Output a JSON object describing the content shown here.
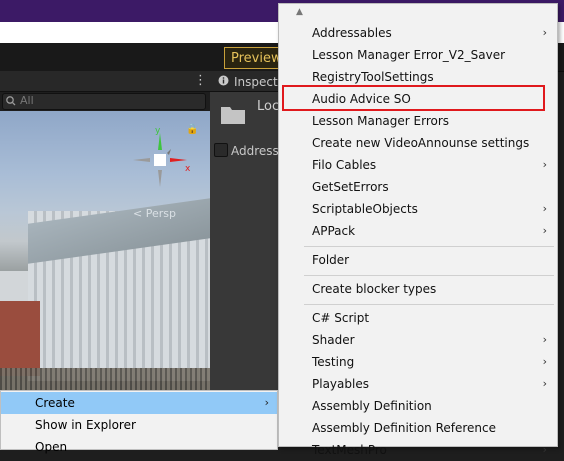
{
  "toolbar": {
    "preview_label": "Preview"
  },
  "scene": {
    "search_placeholder": "All",
    "persp_label": "< Persp",
    "gizmo": {
      "y_label": "y",
      "x_label": "x"
    }
  },
  "inspector": {
    "title": "Inspecto",
    "asset_label": "Loc",
    "address_label": "Address"
  },
  "context_menu": {
    "items": [
      {
        "label": "Create",
        "submenu": true
      },
      {
        "label": "Show in Explorer",
        "submenu": false
      },
      {
        "label": "Open",
        "submenu": false
      }
    ]
  },
  "create_menu": {
    "items": [
      {
        "label": "Addressables",
        "submenu": true
      },
      {
        "label": "Lesson Manager Error_V2_Saver",
        "submenu": false
      },
      {
        "label": "RegistryToolSettings",
        "submenu": false
      },
      {
        "label": "Audio Advice SO",
        "submenu": false
      },
      {
        "label": "Lesson Manager Errors",
        "submenu": false
      },
      {
        "label": "Create new VideoAnnounse settings",
        "submenu": false
      },
      {
        "label": "Filo Cables",
        "submenu": true
      },
      {
        "label": "GetSetErrors",
        "submenu": false
      },
      {
        "label": "ScriptableObjects",
        "submenu": true
      },
      {
        "label": "APPack",
        "submenu": true
      },
      {
        "label": "Folder",
        "submenu": false
      },
      {
        "label": "Create blocker types",
        "submenu": false
      },
      {
        "label": "C# Script",
        "submenu": false
      },
      {
        "label": "Shader",
        "submenu": true
      },
      {
        "label": "Testing",
        "submenu": true
      },
      {
        "label": "Playables",
        "submenu": true
      },
      {
        "label": "Assembly Definition",
        "submenu": false
      },
      {
        "label": "Assembly Definition Reference",
        "submenu": false
      },
      {
        "label": "TextMeshPro",
        "submenu": true
      }
    ],
    "highlighted_item": "Audio Advice SO",
    "highlight_color": "#e0191d"
  },
  "colors": {
    "title_bar": "#3c1a66",
    "preview_accent": "#c9a13a",
    "menu_hover": "#91c9f7"
  }
}
